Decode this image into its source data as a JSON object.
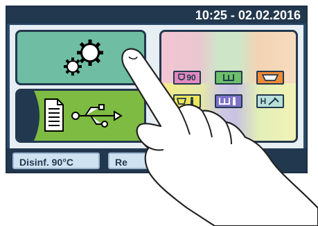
{
  "header": {
    "datetime": "10:25 - 02.02.2016"
  },
  "tiles": {
    "settings": {
      "icon": "gears-icon"
    },
    "usb_export": {
      "icons": [
        "document-icon",
        "usb-icon"
      ]
    }
  },
  "programs": [
    {
      "label": "90",
      "icon": "disinfect-90-icon",
      "color": "#e28ac0"
    },
    {
      "label": "",
      "icon": "tray-icon",
      "color": "#6cc06a"
    },
    {
      "label": "",
      "icon": "basin-icon",
      "color": "#f08a34"
    },
    {
      "label": "",
      "icon": "bowl-person-icon",
      "color": "#ece55a"
    },
    {
      "label": "",
      "icon": "tray-person-icon",
      "color": "#7e72c9"
    },
    {
      "label": "H",
      "icon": "h-tool-icon",
      "color": "#b8e0d8"
    }
  ],
  "footer": {
    "button1": "Disinf. 90°C",
    "button2": "Re"
  },
  "colors": {
    "frame": "#22384f",
    "settings_tile": "#6fbea4",
    "usb_tile": "#7dbb42"
  }
}
